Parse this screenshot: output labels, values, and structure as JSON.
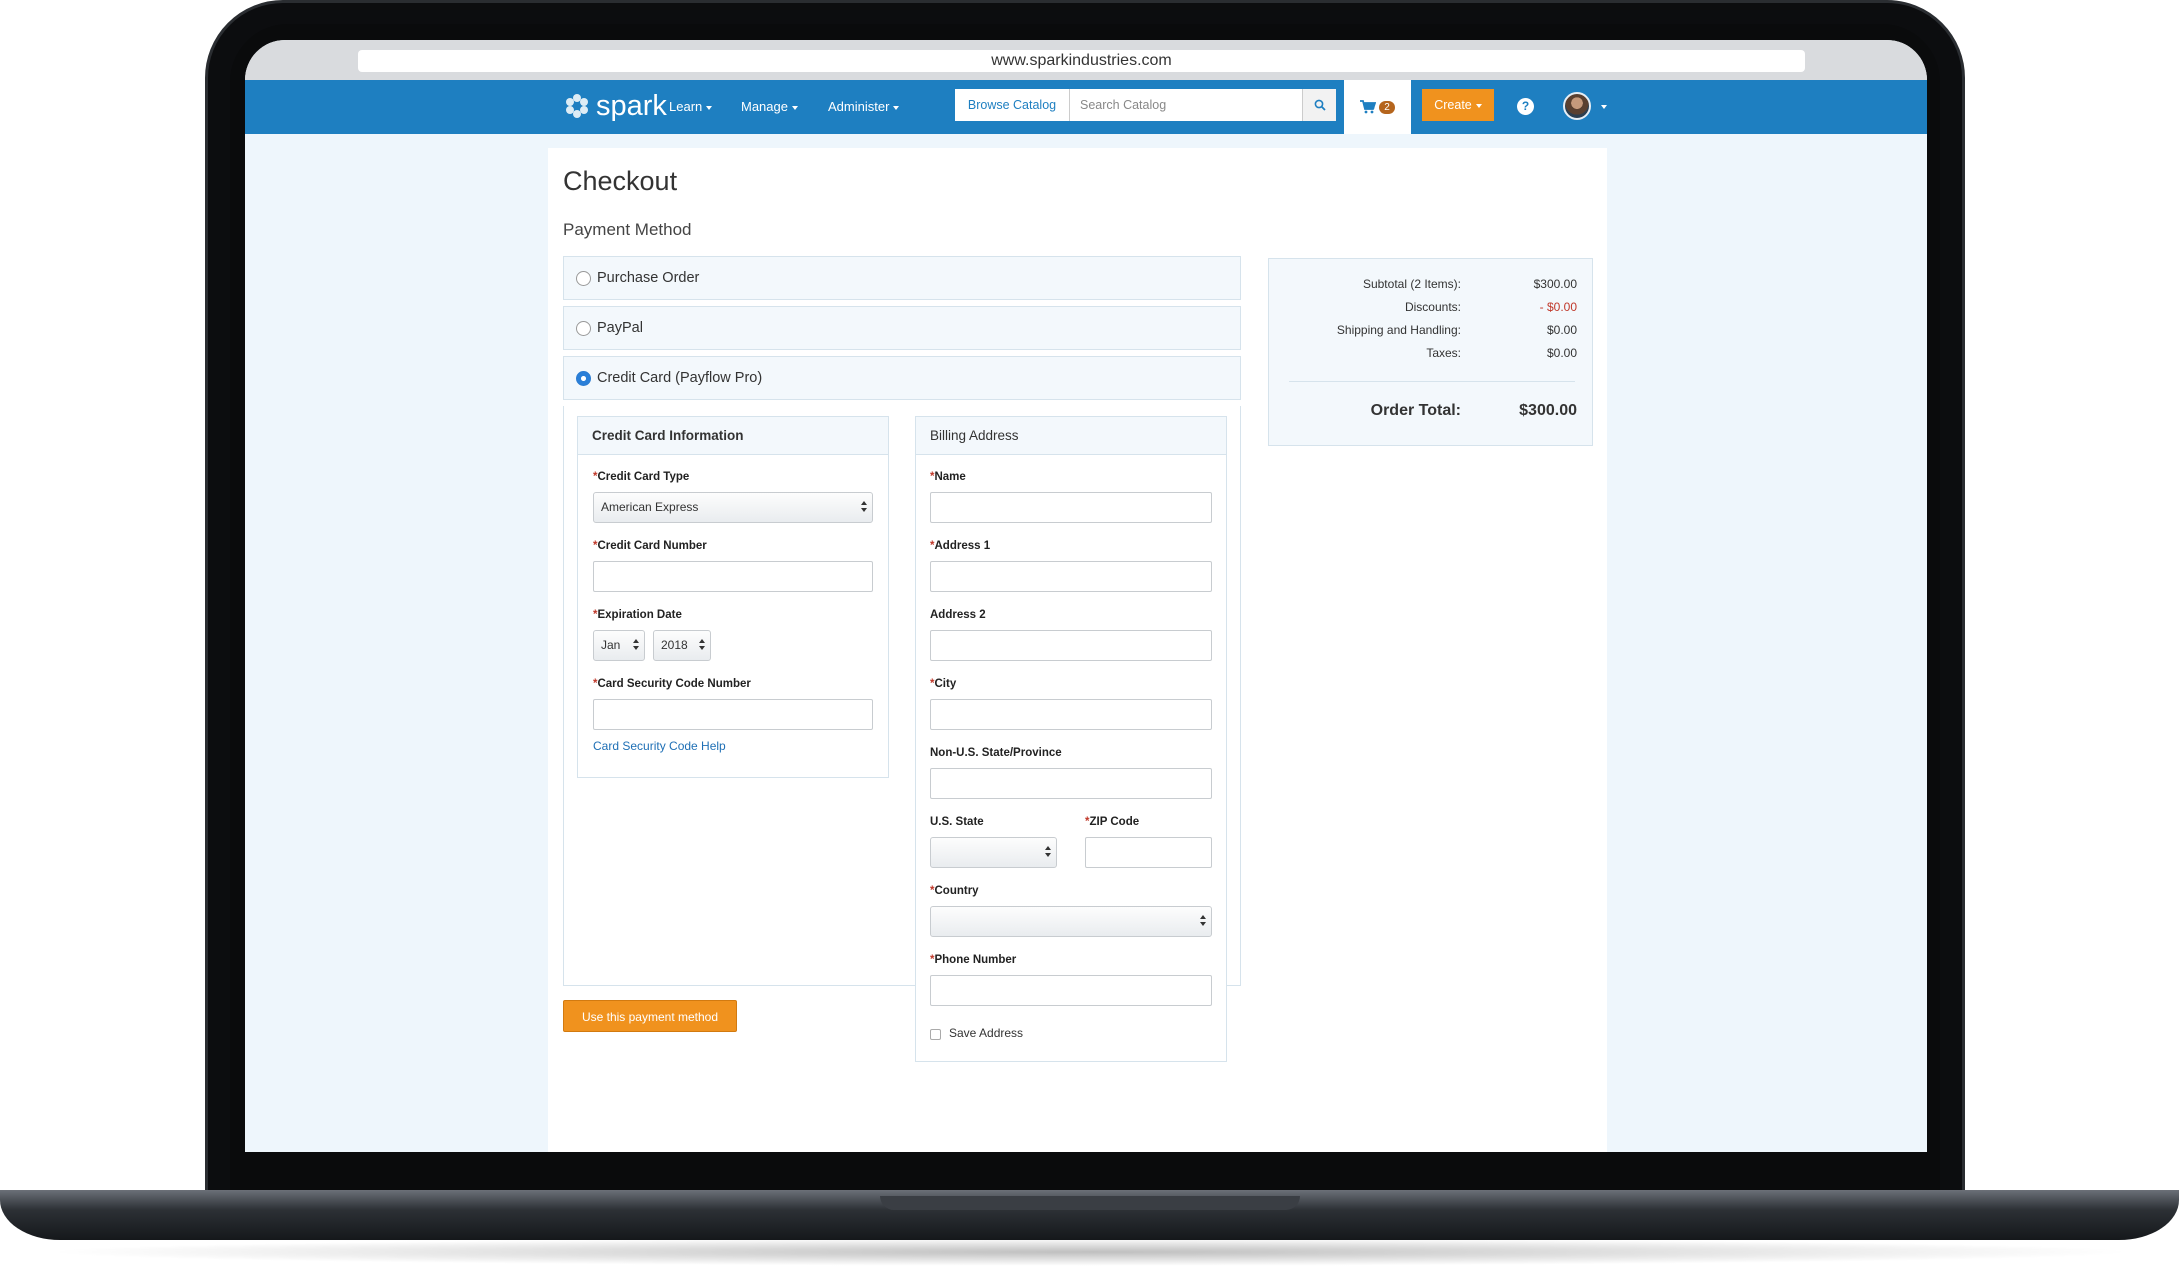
{
  "browser": {
    "url": "www.sparkindustries.com"
  },
  "brand": {
    "name": "spark",
    "logo_icon": "snowflake-logo-icon"
  },
  "nav": {
    "items": [
      {
        "label": "Learn"
      },
      {
        "label": "Manage"
      },
      {
        "label": "Administer"
      }
    ],
    "browse_label": "Browse Catalog",
    "search_placeholder": "Search Catalog",
    "cart_count": "2",
    "create_label": "Create",
    "help_label": "?"
  },
  "page": {
    "title": "Checkout",
    "payment_method_title": "Payment Method",
    "options": [
      {
        "label": "Purchase Order",
        "selected": false
      },
      {
        "label": "PayPal",
        "selected": false
      },
      {
        "label": "Credit Card (Payflow Pro)",
        "selected": true
      }
    ],
    "submit_label": "Use this payment method"
  },
  "credit_card": {
    "header": "Credit Card Information",
    "type_label": "Credit Card Type",
    "type_value": "American Express",
    "number_label": "Credit Card Number",
    "expiration_label": "Expiration Date",
    "exp_month": "Jan",
    "exp_year": "2018",
    "cvv_label": "Card Security Code Number",
    "cvv_help": "Card Security Code Help"
  },
  "billing": {
    "header": "Billing Address",
    "name_label": "Name",
    "address1_label": "Address 1",
    "address2_label": "Address 2",
    "city_label": "City",
    "non_us_state_label": "Non-U.S. State/Province",
    "us_state_label": "U.S. State",
    "zip_label": "ZIP Code",
    "country_label": "Country",
    "phone_label": "Phone Number",
    "save_address_label": "Save Address"
  },
  "summary": {
    "subtotal_label": "Subtotal (2 Items):",
    "subtotal_value": "$300.00",
    "discounts_label": "Discounts:",
    "discounts_value": "- $0.00",
    "shipping_label": "Shipping and Handling:",
    "shipping_value": "$0.00",
    "taxes_label": "Taxes:",
    "taxes_value": "$0.00",
    "total_label": "Order Total:",
    "total_value": "$300.00"
  },
  "colors": {
    "navbar": "#1e7fc1",
    "accent_orange": "#f0921e",
    "panel_bg": "#f3f8fc",
    "discount_red": "#c0392b"
  }
}
